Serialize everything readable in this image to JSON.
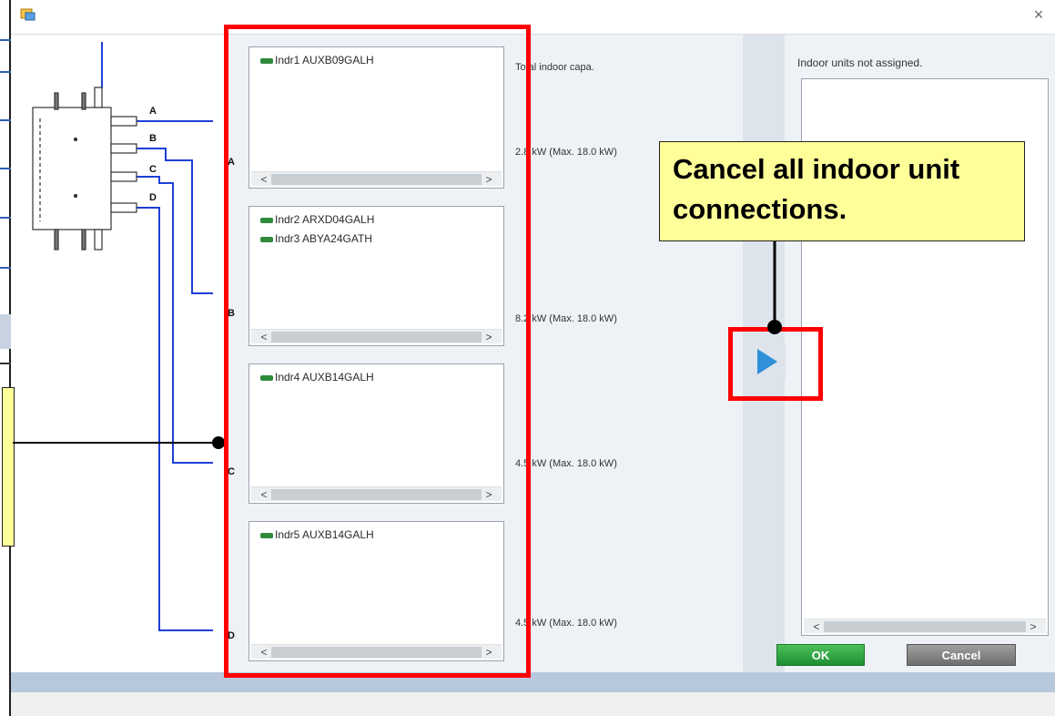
{
  "window": {
    "close_glyph": "×"
  },
  "branches": [
    {
      "port": "A",
      "units": [
        "Indr1 AUXB09GALH"
      ],
      "capacity": "2.8 kW (Max. 18.0 kW)"
    },
    {
      "port": "B",
      "units": [
        "Indr2 ARXD04GALH",
        "Indr3 ABYA24GATH"
      ],
      "capacity": "8.2 kW (Max. 18.0 kW)"
    },
    {
      "port": "C",
      "units": [
        "Indr4 AUXB14GALH"
      ],
      "capacity": "4.5 kW (Max. 18.0 kW)"
    },
    {
      "port": "D",
      "units": [
        "Indr5 AUXB14GALH"
      ],
      "capacity": "4.5 kW (Max. 18.0 kW)"
    }
  ],
  "diagram": {
    "port_labels": [
      "A",
      "B",
      "C",
      "D"
    ]
  },
  "total_capa_label": "Total indoor capa.",
  "unassigned": {
    "label": "Indoor units not assigned.",
    "items": []
  },
  "scroll": {
    "left": "<",
    "right": ">"
  },
  "buttons": {
    "ok": "OK",
    "cancel": "Cancel"
  },
  "callout": {
    "text": "Cancel all indoor unit connections."
  },
  "colors": {
    "annotation_red": "#ff0000",
    "callout_yellow": "#ffff99",
    "pipe_blue": "#1d3fd6",
    "ok_green": "#2aa33c",
    "move_arrow_blue": "#2f8fd8"
  },
  "icons": {
    "app": "app-window-icon",
    "close": "close-icon",
    "move": "move-right-icon",
    "unit": "indoor-unit-icon"
  }
}
